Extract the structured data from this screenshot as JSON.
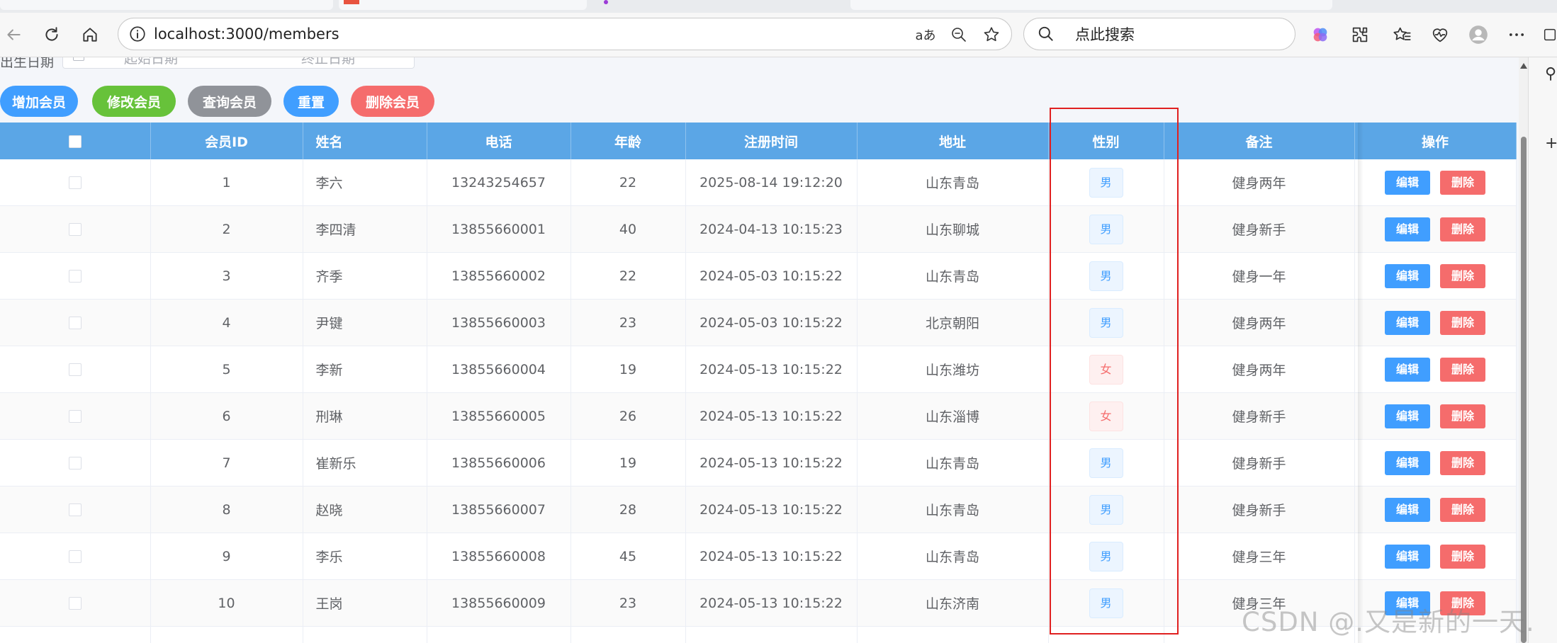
{
  "browser": {
    "url": "localhost:3000/members",
    "search_placeholder": "点此搜索",
    "read_aloud_label": "aあ"
  },
  "filters": {
    "date_label": "出生日期",
    "start_placeholder": "起始日期",
    "end_placeholder": "终止日期"
  },
  "actions": {
    "add": "增加会员",
    "edit": "修改会员",
    "query": "查询会员",
    "reset": "重置",
    "delete": "删除会员"
  },
  "table": {
    "headers": {
      "id": "会员ID",
      "name": "姓名",
      "phone": "电话",
      "age": "年龄",
      "reg_time": "注册时间",
      "address": "地址",
      "gender": "性别",
      "remark": "备注",
      "ops": "操作"
    },
    "edit_label": "编辑",
    "delete_label": "删除",
    "rows": [
      {
        "id": "1",
        "name": "李六",
        "phone": "13243254657",
        "age": "22",
        "reg_time": "2025-08-14 19:12:20",
        "address": "山东青岛",
        "gender": "男",
        "remark": "健身两年"
      },
      {
        "id": "2",
        "name": "李四清",
        "phone": "13855660001",
        "age": "40",
        "reg_time": "2024-04-13 10:15:23",
        "address": "山东聊城",
        "gender": "男",
        "remark": "健身新手"
      },
      {
        "id": "3",
        "name": "齐季",
        "phone": "13855660002",
        "age": "22",
        "reg_time": "2024-05-03 10:15:22",
        "address": "山东青岛",
        "gender": "男",
        "remark": "健身一年"
      },
      {
        "id": "4",
        "name": "尹键",
        "phone": "13855660003",
        "age": "23",
        "reg_time": "2024-05-03 10:15:22",
        "address": "北京朝阳",
        "gender": "男",
        "remark": "健身两年"
      },
      {
        "id": "5",
        "name": "李新",
        "phone": "13855660004",
        "age": "19",
        "reg_time": "2024-05-13 10:15:22",
        "address": "山东潍坊",
        "gender": "女",
        "remark": "健身两年"
      },
      {
        "id": "6",
        "name": "刑琳",
        "phone": "13855660005",
        "age": "26",
        "reg_time": "2024-05-13 10:15:22",
        "address": "山东淄博",
        "gender": "女",
        "remark": "健身新手"
      },
      {
        "id": "7",
        "name": "崔新乐",
        "phone": "13855660006",
        "age": "19",
        "reg_time": "2024-05-13 10:15:22",
        "address": "山东青岛",
        "gender": "男",
        "remark": "健身新手"
      },
      {
        "id": "8",
        "name": "赵晓",
        "phone": "13855660007",
        "age": "28",
        "reg_time": "2024-05-13 10:15:22",
        "address": "山东青岛",
        "gender": "男",
        "remark": "健身新手"
      },
      {
        "id": "9",
        "name": "李乐",
        "phone": "13855660008",
        "age": "45",
        "reg_time": "2024-05-13 10:15:22",
        "address": "山东青岛",
        "gender": "男",
        "remark": "健身三年"
      },
      {
        "id": "10",
        "name": "王岗",
        "phone": "13855660009",
        "age": "23",
        "reg_time": "2024-05-13 10:15:22",
        "address": "山东济南",
        "gender": "男",
        "remark": "健身三年"
      }
    ]
  },
  "watermark": "CSDN @.又是新的一天.",
  "colors": {
    "header_bg": "#5ba6e6",
    "primary": "#409eff",
    "success": "#67c23a",
    "info": "#909399",
    "danger": "#f56c6c",
    "highlight_border": "#e02020"
  }
}
